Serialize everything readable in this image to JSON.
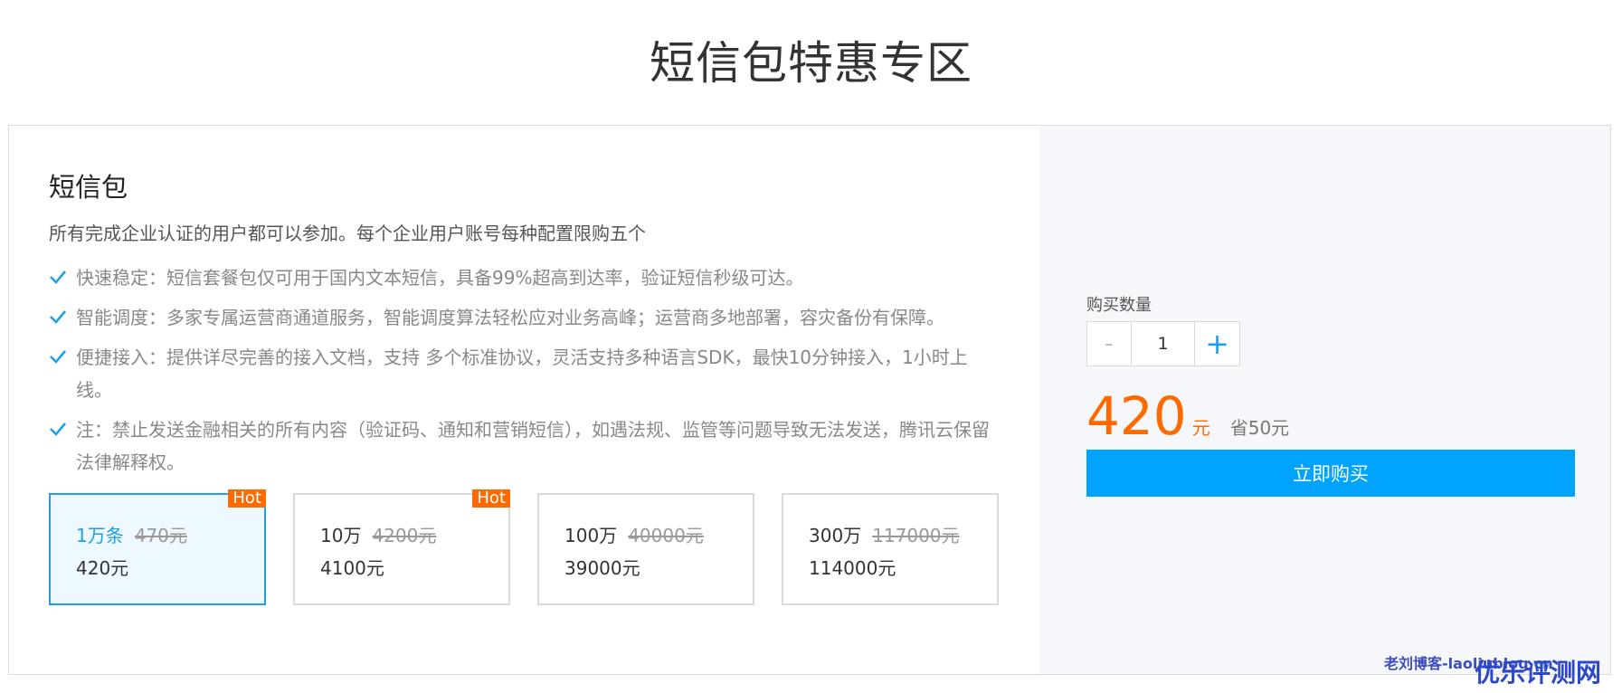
{
  "page": {
    "title": "短信包特惠专区"
  },
  "package": {
    "title": "短信包",
    "description": "所有完成企业认证的用户都可以参加。每个企业用户账号每种配置限购五个",
    "features": [
      "快速稳定：短信套餐包仅可用于国内文本短信，具备99%超高到达率，验证短信秒级可达。",
      "智能调度：多家专属运营商通道服务，智能调度算法轻松应对业务高峰；运营商多地部署，容灾备份有保障。",
      "便捷接入：提供详尽完善的接入文档，支持 多个标准协议，灵活支持多种语言SDK，最快10分钟接入，1小时上线。",
      "注：禁止发送金融相关的所有内容（验证码、通知和营销短信），如遇法规、监管等问题导致无法发送，腾讯云保留法律解释权。"
    ],
    "options": [
      {
        "amount": "1万条",
        "old_price": "470元",
        "price": "420元",
        "badge": "Hot"
      },
      {
        "amount": "10万",
        "old_price": "4200元",
        "price": "4100元",
        "badge": "Hot"
      },
      {
        "amount": "100万",
        "old_price": "40000元",
        "price": "39000元",
        "badge": ""
      },
      {
        "amount": "300万",
        "old_price": "117000元",
        "price": "114000元",
        "badge": ""
      }
    ]
  },
  "purchase": {
    "quantity_label": "购买数量",
    "minus_label": "-",
    "plus_label": "+",
    "quantity": "1",
    "price": "420",
    "price_unit": "元",
    "saving": "省50元",
    "buy_label": "立即购买"
  },
  "watermark": {
    "text1": "老刘博客-laoliublog.cn",
    "text2": "优乐评测网"
  },
  "colors": {
    "accent": "#1e9fe6",
    "orange": "#ff6a00",
    "button": "#00a4ff"
  }
}
